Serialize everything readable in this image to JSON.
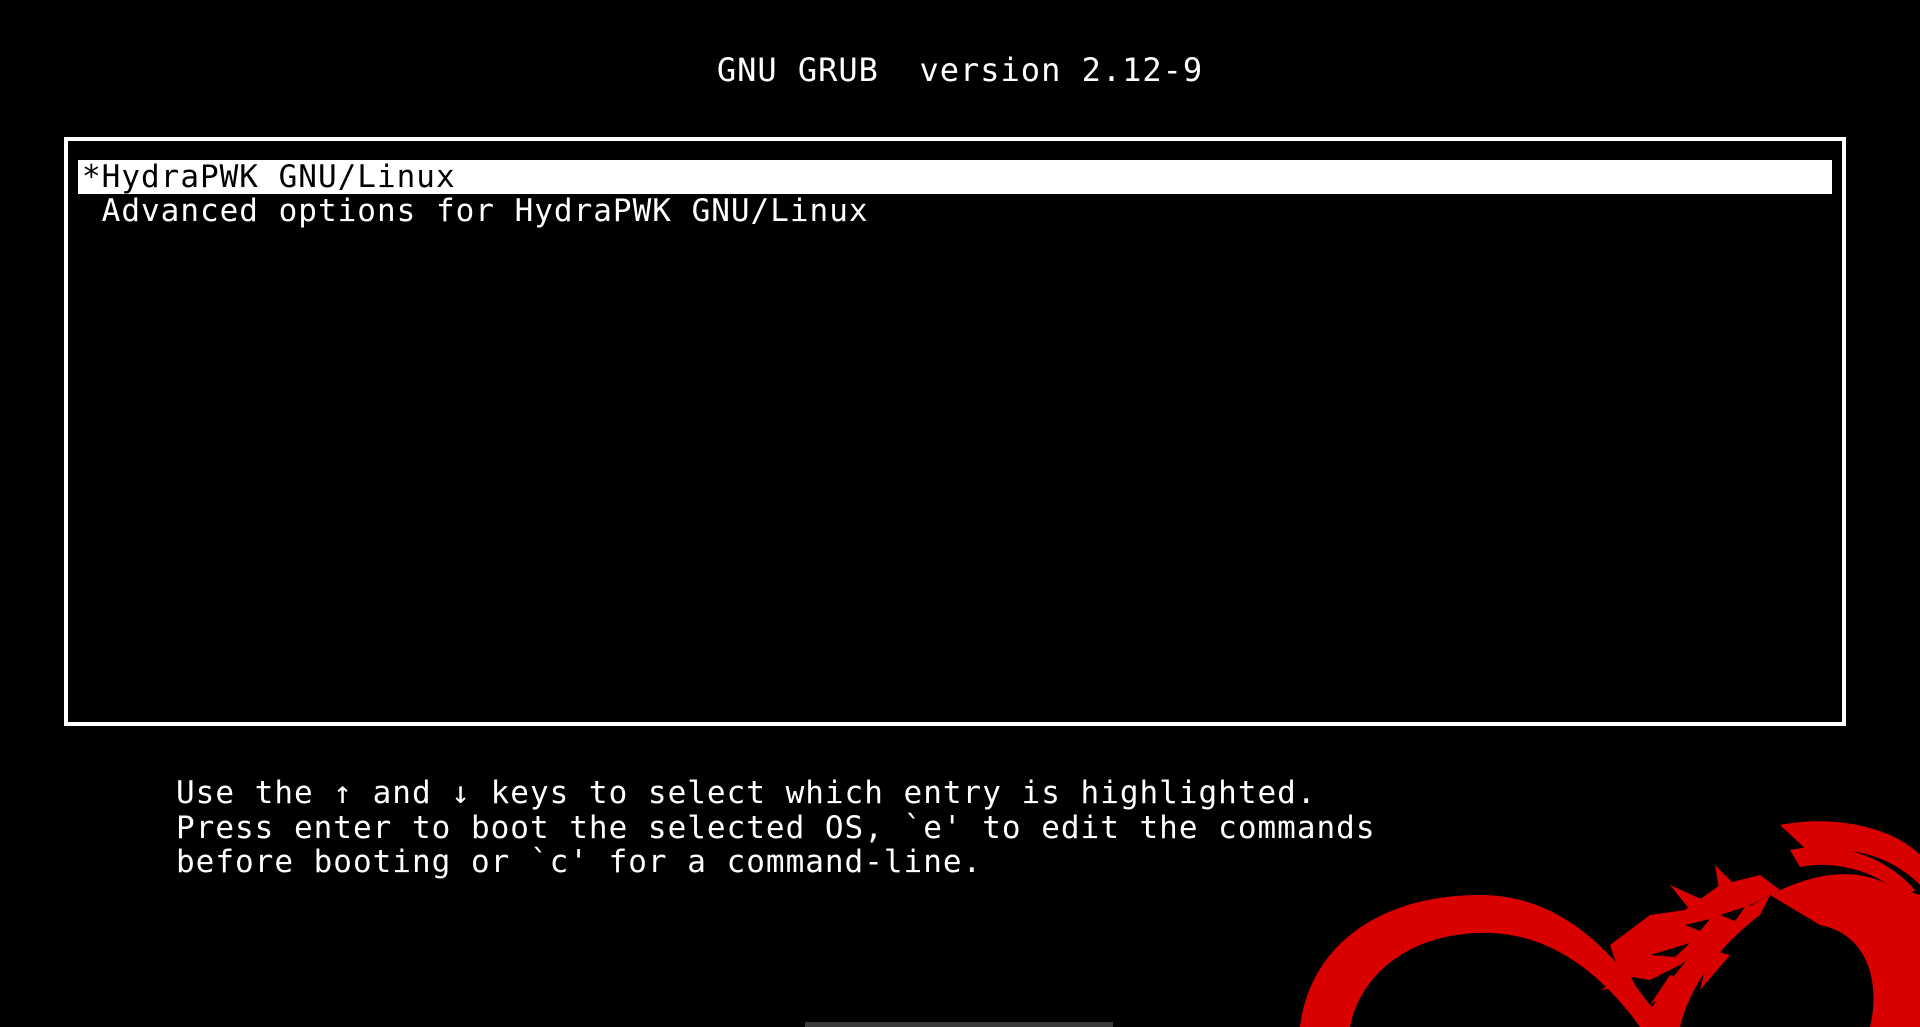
{
  "header": {
    "title": "GNU GRUB  version 2.12-9"
  },
  "menu": {
    "items": [
      {
        "label": "*HydraPWK GNU/Linux",
        "selected": true
      },
      {
        "label": " Advanced options for HydraPWK GNU/Linux",
        "selected": false
      }
    ]
  },
  "instructions": {
    "line1": "Use the ↑ and ↓ keys to select which entry is highlighted.",
    "line2": "Press enter to boot the selected OS, `e' to edit the commands",
    "line3": "before booting or `c' for a command-line."
  },
  "logo": {
    "icon": "hydra-dragon-icon",
    "color": "#d90000"
  },
  "colors": {
    "background": "#000000",
    "foreground": "#ffffff",
    "highlight_bg": "#ffffff",
    "highlight_fg": "#000000"
  }
}
